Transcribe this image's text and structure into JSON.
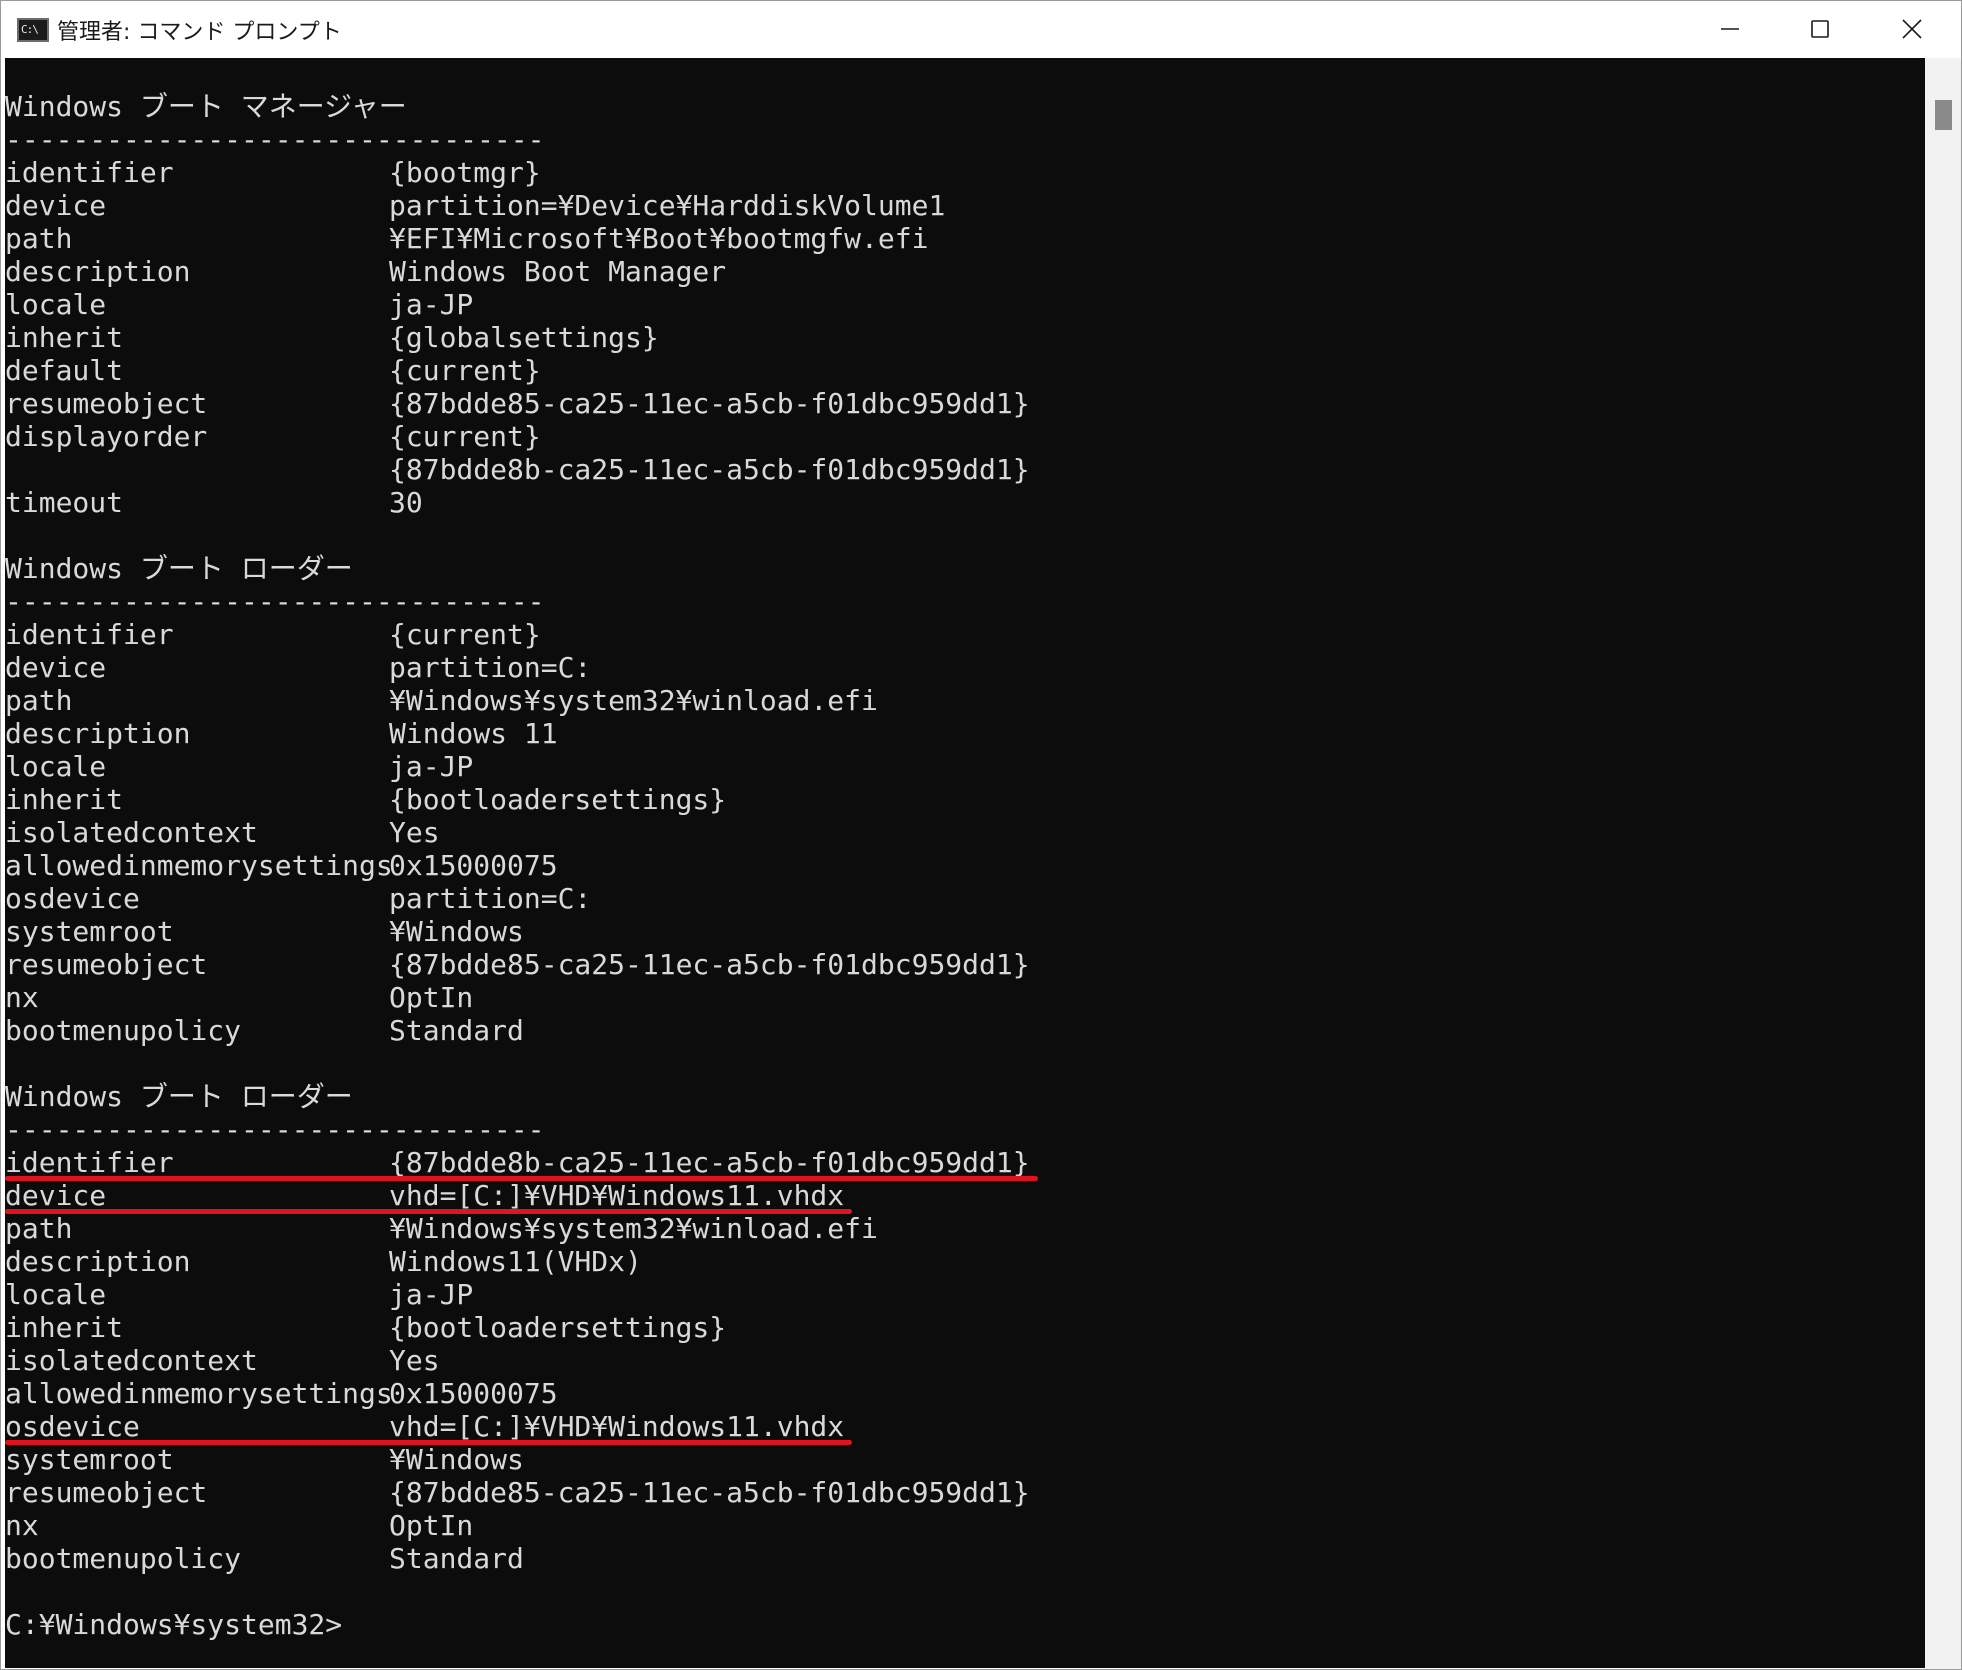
{
  "window": {
    "title": "管理者: コマンド プロンプト",
    "icon_label": "C:\\",
    "buttons": {
      "minimize": "minimize-icon",
      "maximize": "maximize-icon",
      "close": "close-icon"
    }
  },
  "colors": {
    "console_bg": "#0c0c0c",
    "console_text": "#d9d9d9",
    "highlight_underline": "#e0141e"
  },
  "console": {
    "lines": [
      {
        "text": "Windows ブート マネージャー"
      },
      {
        "text": "--------------------------------"
      },
      {
        "key": "identifier",
        "value": "{bootmgr}"
      },
      {
        "key": "device",
        "value": "partition=¥Device¥HarddiskVolume1"
      },
      {
        "key": "path",
        "value": "¥EFI¥Microsoft¥Boot¥bootmgfw.efi"
      },
      {
        "key": "description",
        "value": "Windows Boot Manager"
      },
      {
        "key": "locale",
        "value": "ja-JP"
      },
      {
        "key": "inherit",
        "value": "{globalsettings}"
      },
      {
        "key": "default",
        "value": "{current}"
      },
      {
        "key": "resumeobject",
        "value": "{87bdde85-ca25-11ec-a5cb-f01dbc959dd1}"
      },
      {
        "key": "displayorder",
        "value": "{current}"
      },
      {
        "key": "",
        "value": "{87bdde8b-ca25-11ec-a5cb-f01dbc959dd1}"
      },
      {
        "key": "timeout",
        "value": "30"
      },
      {
        "text": ""
      },
      {
        "text": "Windows ブート ローダー"
      },
      {
        "text": "--------------------------------"
      },
      {
        "key": "identifier",
        "value": "{current}"
      },
      {
        "key": "device",
        "value": "partition=C:"
      },
      {
        "key": "path",
        "value": "¥Windows¥system32¥winload.efi"
      },
      {
        "key": "description",
        "value": "Windows 11"
      },
      {
        "key": "locale",
        "value": "ja-JP"
      },
      {
        "key": "inherit",
        "value": "{bootloadersettings}"
      },
      {
        "key": "isolatedcontext",
        "value": "Yes"
      },
      {
        "key": "allowedinmemorysettings",
        "value": "0x15000075"
      },
      {
        "key": "osdevice",
        "value": "partition=C:"
      },
      {
        "key": "systemroot",
        "value": "¥Windows"
      },
      {
        "key": "resumeobject",
        "value": "{87bdde85-ca25-11ec-a5cb-f01dbc959dd1}"
      },
      {
        "key": "nx",
        "value": "OptIn"
      },
      {
        "key": "bootmenupolicy",
        "value": "Standard"
      },
      {
        "text": ""
      },
      {
        "text": "Windows ブート ローダー"
      },
      {
        "text": "--------------------------------"
      },
      {
        "key": "identifier",
        "value": "{87bdde8b-ca25-11ec-a5cb-f01dbc959dd1}",
        "highlighted": true
      },
      {
        "key": "device",
        "value": "vhd=[C:]¥VHD¥Windows11.vhdx",
        "highlighted": true
      },
      {
        "key": "path",
        "value": "¥Windows¥system32¥winload.efi"
      },
      {
        "key": "description",
        "value": "Windows11(VHDx)"
      },
      {
        "key": "locale",
        "value": "ja-JP"
      },
      {
        "key": "inherit",
        "value": "{bootloadersettings}"
      },
      {
        "key": "isolatedcontext",
        "value": "Yes"
      },
      {
        "key": "allowedinmemorysettings",
        "value": "0x15000075"
      },
      {
        "key": "osdevice",
        "value": "vhd=[C:]¥VHD¥Windows11.vhdx",
        "highlighted": true
      },
      {
        "key": "systemroot",
        "value": "¥Windows"
      },
      {
        "key": "resumeobject",
        "value": "{87bdde85-ca25-11ec-a5cb-f01dbc959dd1}"
      },
      {
        "key": "nx",
        "value": "OptIn"
      },
      {
        "key": "bootmenupolicy",
        "value": "Standard"
      },
      {
        "text": ""
      },
      {
        "text": "C:¥Windows¥system32>"
      }
    ]
  }
}
